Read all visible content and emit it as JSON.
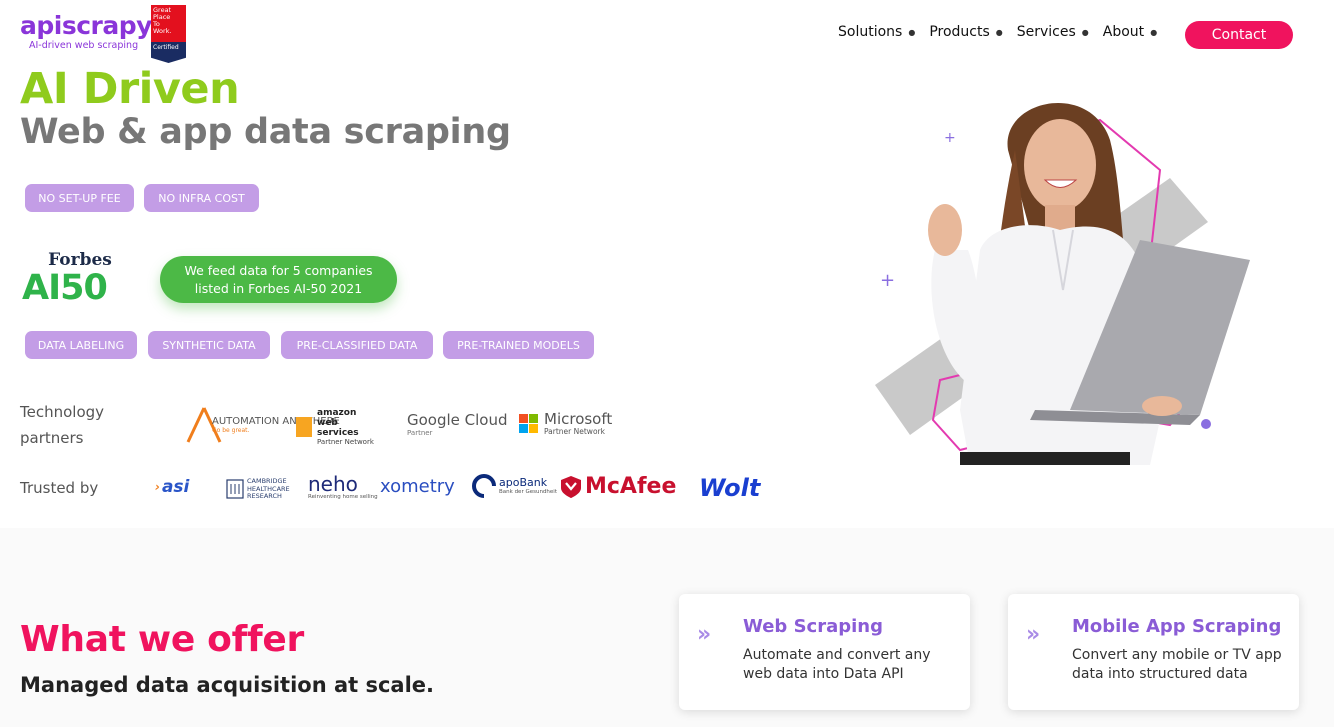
{
  "header": {
    "logo_text": "apiscrapy",
    "logo_tagline": "AI-driven web scraping",
    "badge_lines": [
      "Great",
      "Place",
      "To",
      "Work.",
      "Certified"
    ],
    "nav": [
      {
        "label": "Solutions"
      },
      {
        "label": "Products"
      },
      {
        "label": "Services"
      },
      {
        "label": "About"
      }
    ],
    "contact_label": "Contact"
  },
  "hero": {
    "title": "AI Driven",
    "subtitle": "Web & app data scraping",
    "pills_top": [
      "NO SET-UP FEE",
      "NO INFRA COST"
    ],
    "forbes_word": "Forbes",
    "forbes_ai50": "AI50",
    "forbes_callout": "We feed data for 5 companies listed in Forbes AI-50 2021",
    "pills_services": [
      "DATA LABELING",
      "SYNTHETIC DATA",
      "PRE-CLASSIFIED DATA",
      "PRE-TRAINED MODELS"
    ],
    "tech_label": "Technology partners",
    "tech_partners": [
      {
        "name": "AUTOMATION ANYWHERE",
        "sub": "Go be great."
      },
      {
        "name": "amazon web services",
        "sub": "Partner Network"
      },
      {
        "name": "Google Cloud",
        "sub": "Partner"
      },
      {
        "name": "Microsoft",
        "sub": "Partner Network"
      }
    ],
    "trusted_label": "Trusted by",
    "trusted": [
      {
        "name": "asi"
      },
      {
        "name": "CAMBRIDGE HEALTHCARE RESEARCH"
      },
      {
        "name": "neho",
        "sub": "Reinventing home selling"
      },
      {
        "name": "xometry"
      },
      {
        "name": "apoBank",
        "sub": "Bank der Gesundheit"
      },
      {
        "name": "McAfee"
      },
      {
        "name": "Wolt"
      }
    ]
  },
  "offer": {
    "title": "What we offer",
    "subtitle": "Managed data acquisition at scale.",
    "cards": [
      {
        "title": "Web Scraping",
        "desc": "Automate and convert any web data into Data API"
      },
      {
        "title": "Mobile App Scraping",
        "desc": "Convert any mobile or TV app data into structured data"
      }
    ]
  },
  "colors": {
    "brand_purple": "#8a35d9",
    "accent_pink": "#f0135e",
    "hero_green": "#8fcb1d",
    "pill_purple": "#c39de6",
    "forbes_green": "#4cb946"
  }
}
